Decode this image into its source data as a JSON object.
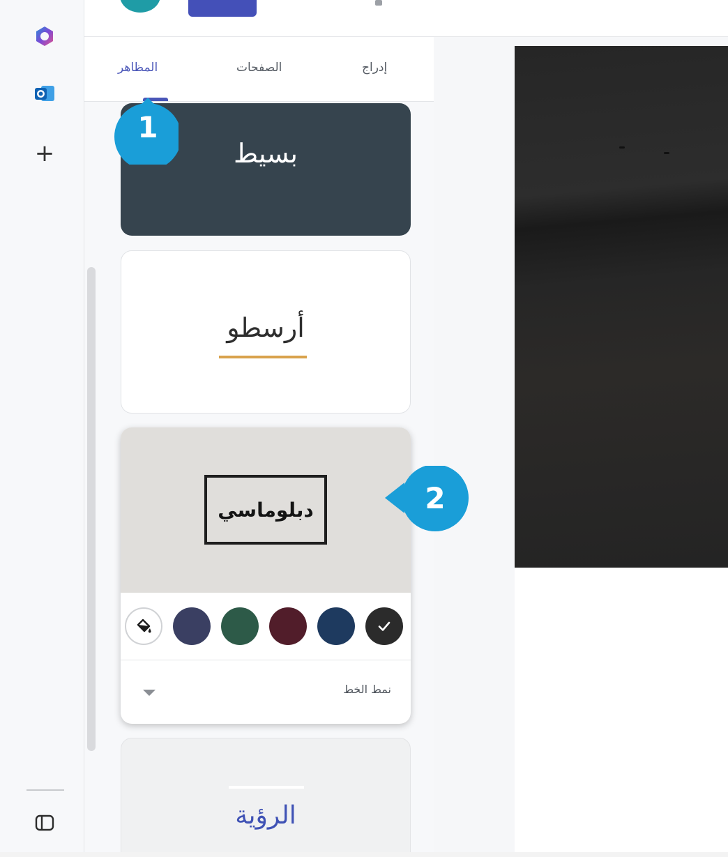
{
  "tabs": {
    "insert": "إدراج",
    "pages": "الصفحات",
    "themes": "المظاهر"
  },
  "themes": {
    "basic": "بسيط",
    "aristotle": "أرسطو",
    "diplomatic": "دبلوماسي",
    "vision": "الرؤية"
  },
  "style_options": {
    "font_style_label": "نمط الخط",
    "colors": [
      "#3a3f62",
      "#2d5a48",
      "#511d2a",
      "#1e3a5f",
      "#2b2b2b"
    ],
    "selected_color_index": 4
  },
  "callouts": {
    "one": "1",
    "two": "2"
  },
  "accent": "#4a56b8",
  "callout_color": "#1a9ed8",
  "icons": [
    "copilot-icon",
    "outlook-icon",
    "plus-icon",
    "sidebar-toggle-icon",
    "paint-bucket-icon",
    "check-icon",
    "chevron-down-icon"
  ]
}
